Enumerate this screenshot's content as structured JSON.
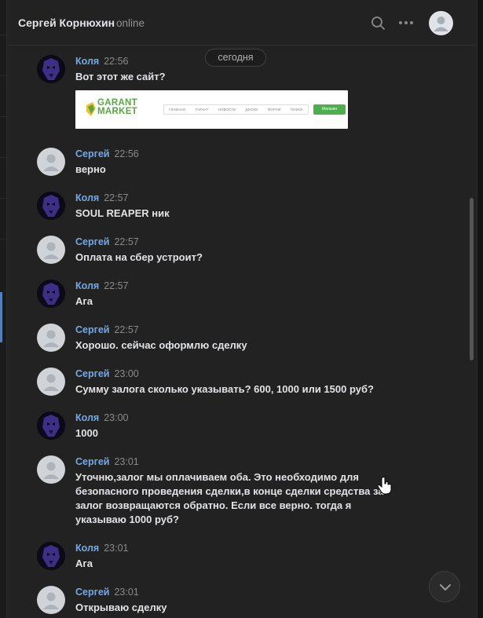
{
  "header": {
    "title": "Сергей Корнюхин",
    "status": "online",
    "search_icon": "search-icon",
    "more_icon": "more-dots-icon",
    "avatar_icon": "user-avatar-icon"
  },
  "date_separator": "сегодня",
  "attachment": {
    "logo_line1": "GARANT",
    "logo_line2": "MARKET",
    "nav_items": [
      "ГЛАВНАЯ",
      "ГАРАНТ",
      "НОВОСТИ",
      "ДОСКИ",
      "ФОРУМ",
      "ПОИСК"
    ],
    "button_label": "Магазин"
  },
  "messages": [
    {
      "author": "Коля",
      "time": "22:56",
      "text": "Вот этот же сайт?"
    },
    {
      "author": "Сергей",
      "time": "22:56",
      "text": "верно"
    },
    {
      "author": "Коля",
      "time": "22:57",
      "text": "SOUL REAPER ник"
    },
    {
      "author": "Сергей",
      "time": "22:57",
      "text": "Оплата на сбер устроит?"
    },
    {
      "author": "Коля",
      "time": "22:57",
      "text": "Ага"
    },
    {
      "author": "Сергей",
      "time": "22:57",
      "text": "Хорошо. сейчас оформлю сделку"
    },
    {
      "author": "Сергей",
      "time": "23:00",
      "text": "Сумму залога сколько указывать? 600, 1000 или 1500 руб?"
    },
    {
      "author": "Коля",
      "time": "23:00",
      "text": "1000"
    },
    {
      "author": "Сергей",
      "time": "23:01",
      "text": "Уточню,залог мы оплачиваем оба. Это необходимо для безопасного проведения сделки,в конце сделки средства за залог возвращаются обратно. Если все верно. тогда я указываю 1000 руб?"
    },
    {
      "author": "Коля",
      "time": "23:01",
      "text": "Ага"
    },
    {
      "author": "Сергей",
      "time": "23:01",
      "text": "Открываю сделку"
    }
  ],
  "colors": {
    "background": "#222222",
    "author_name": "#71aaeb",
    "text": "#e1e3e6",
    "muted": "#8a8a8a"
  },
  "scroll_down_icon": "chevron-down-icon"
}
